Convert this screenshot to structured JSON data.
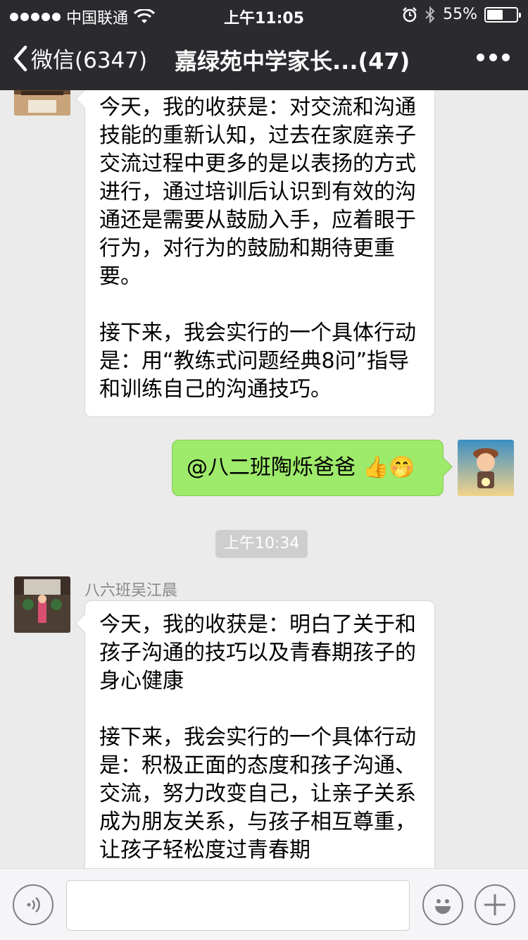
{
  "status_bar": {
    "carrier": "中国联通",
    "time": "上午11:05",
    "battery_percent": "55%",
    "battery_level": 0.55
  },
  "nav": {
    "back_label": "微信(6347)",
    "title": "嘉绿苑中学家长...(47)"
  },
  "messages": [
    {
      "direction": "incoming",
      "paragraphs": [
        "今天，我的收获是：对交流和沟通技能的重新认知，过去在家庭亲子交流过程中更多的是以表扬的方式进行，通过培训后认识到有效的沟通还是需要从鼓励入手，应着眼于行为，对行为的鼓励和期待更重要。",
        "接下来，我会实行的一个具体行动是：用“教练式问题经典8问”指导和训练自己的沟通技巧。"
      ]
    },
    {
      "direction": "outgoing",
      "text": "@八二班陶烁爸爸",
      "emoji": "👍🤭"
    },
    {
      "type": "timestamp",
      "text": "上午10:34"
    },
    {
      "direction": "incoming",
      "sender": "八六班吴江晨",
      "paragraphs": [
        "今天，我的收获是：明白了关于和孩子沟通的技巧以及青春期孩子的身心健康",
        "接下来，我会实行的一个具体行动是：积极正面的态度和孩子沟通、交流，努力改变自己，让亲子关系成为朋友关系，与孩子相互尊重，让孩子轻松度过青春期"
      ]
    }
  ],
  "colors": {
    "header_bg": "#2b2a2f",
    "chat_bg": "#ebebeb",
    "outgoing_bubble": "#9eea6a",
    "incoming_bubble": "#ffffff"
  }
}
